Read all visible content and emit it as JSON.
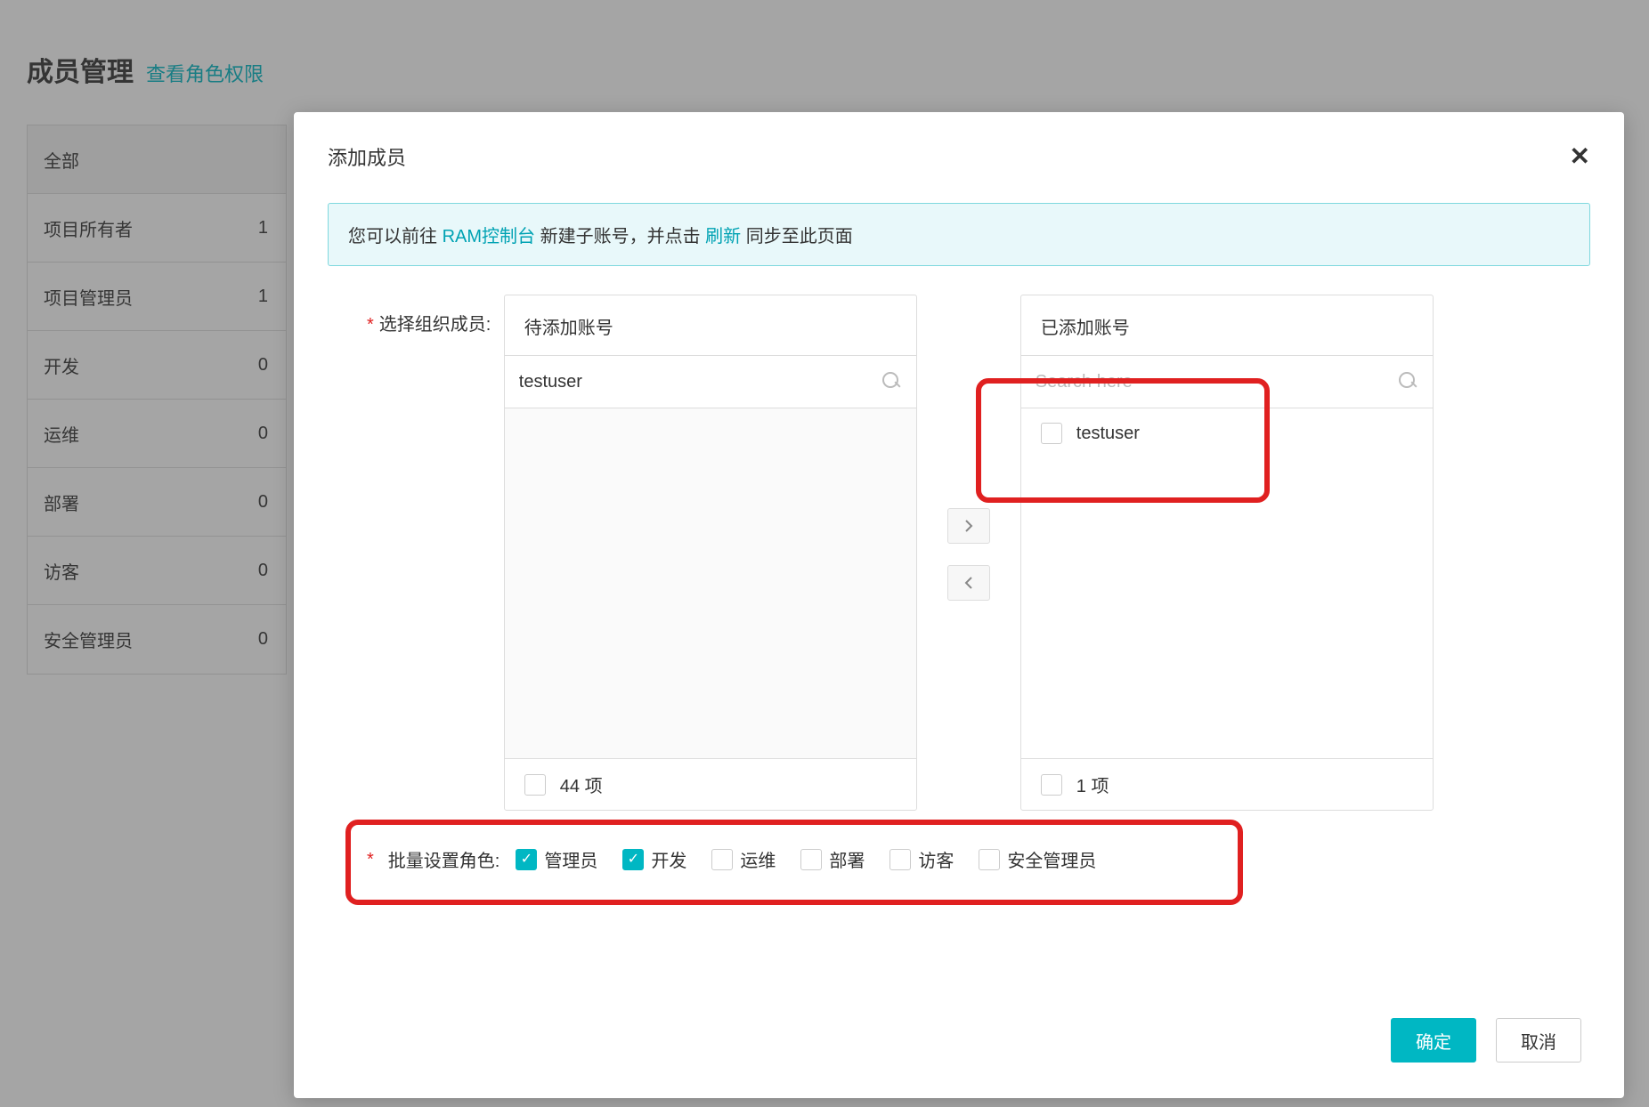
{
  "page": {
    "title": "成员管理",
    "view_roles_link": "查看角色权限",
    "role_list": {
      "header": "全部",
      "items": [
        {
          "name": "项目所有者",
          "count": "1"
        },
        {
          "name": "项目管理员",
          "count": "1"
        },
        {
          "name": "开发",
          "count": "0"
        },
        {
          "name": "运维",
          "count": "0"
        },
        {
          "name": "部署",
          "count": "0"
        },
        {
          "name": "访客",
          "count": "0"
        },
        {
          "name": "安全管理员",
          "count": "0"
        }
      ]
    }
  },
  "modal": {
    "title": "添加成员",
    "info": {
      "prefix": "您可以前往 ",
      "ram_link": "RAM控制台",
      "mid": " 新建子账号，并点击 ",
      "refresh_link": "刷新",
      "suffix": " 同步至此页面"
    },
    "select_label": "选择组织成员:",
    "left_panel": {
      "title": "待添加账号",
      "search_value": "testuser",
      "footer": "44 项"
    },
    "right_panel": {
      "title": "已添加账号",
      "search_placeholder": "Search here",
      "items": [
        {
          "label": "testuser",
          "checked": false
        }
      ],
      "footer": "1 项"
    },
    "roles_label": "批量设置角色:",
    "roles": [
      {
        "label": "管理员",
        "checked": true
      },
      {
        "label": "开发",
        "checked": true
      },
      {
        "label": "运维",
        "checked": false
      },
      {
        "label": "部署",
        "checked": false
      },
      {
        "label": "访客",
        "checked": false
      },
      {
        "label": "安全管理员",
        "checked": false
      }
    ],
    "ok": "确定",
    "cancel": "取消"
  }
}
